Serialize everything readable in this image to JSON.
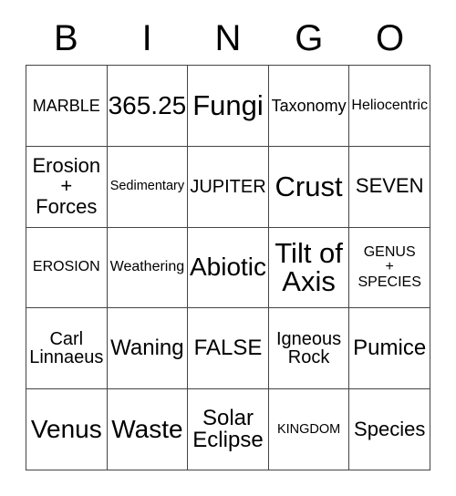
{
  "card": {
    "header_letters": [
      "B",
      "I",
      "N",
      "G",
      "O"
    ],
    "columns": 5,
    "rows": 5,
    "border_color": "#444444",
    "text_color": "#000000",
    "background_color": "#ffffff",
    "cells": [
      [
        {
          "text": "MARBLE",
          "size": "fs-sm"
        },
        {
          "text": "365.25",
          "size": "fs-xl"
        },
        {
          "text": "Fungi",
          "size": "fs-xxl"
        },
        {
          "text": "Taxonomy",
          "size": "fs-sm"
        },
        {
          "text": "Heliocentric",
          "size": "fs-s"
        }
      ],
      [
        {
          "text": "Erosion\n+\nForces",
          "size": "fs-ml"
        },
        {
          "text": "Sedimentary",
          "size": "fs-xs"
        },
        {
          "text": "JUPITER",
          "size": "fs-m"
        },
        {
          "text": "Crust",
          "size": "fs-xxl"
        },
        {
          "text": "SEVEN",
          "size": "fs-ml"
        }
      ],
      [
        {
          "text": "EROSION",
          "size": "fs-s"
        },
        {
          "text": "Weathering",
          "size": "fs-s"
        },
        {
          "text": "Abiotic",
          "size": "fs-xl"
        },
        {
          "text": "Tilt of\nAxis",
          "size": "fs-xxl"
        },
        {
          "text": "GENUS\n+\nSPECIES",
          "size": "fs-s"
        }
      ],
      [
        {
          "text": "Carl\nLinnaeus",
          "size": "fs-m"
        },
        {
          "text": "Waning",
          "size": "fs-l"
        },
        {
          "text": "FALSE",
          "size": "fs-l"
        },
        {
          "text": "Igneous\nRock",
          "size": "fs-m"
        },
        {
          "text": "Pumice",
          "size": "fs-l"
        }
      ],
      [
        {
          "text": "Venus",
          "size": "fs-xl"
        },
        {
          "text": "Waste",
          "size": "fs-xl"
        },
        {
          "text": "Solar\nEclipse",
          "size": "fs-l"
        },
        {
          "text": "KINGDOM",
          "size": "fs-xs"
        },
        {
          "text": "Species",
          "size": "fs-ml"
        }
      ]
    ]
  }
}
